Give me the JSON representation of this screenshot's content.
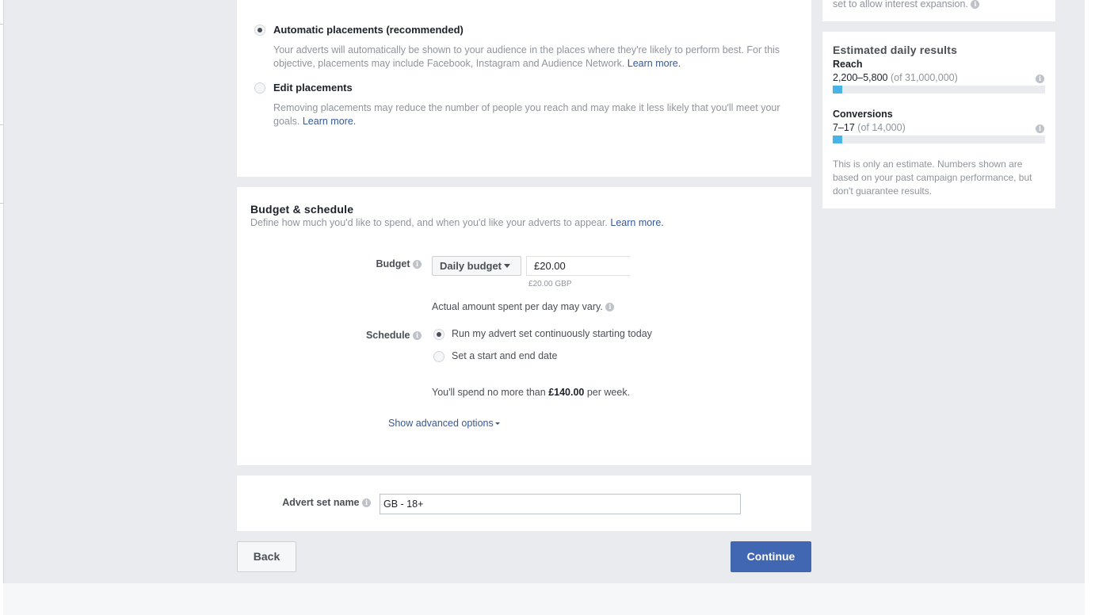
{
  "placements": {
    "options": [
      {
        "title": "Automatic placements (recommended)",
        "selected": true,
        "description": "Your adverts will automatically be shown to your audience in the places where they're likely to perform best. For this objective, placements may include Facebook, Instagram and Audience Network.",
        "link": "Learn more."
      },
      {
        "title": "Edit placements",
        "selected": false,
        "description": "Removing placements may reduce the number of people you reach and may make it less likely that you'll meet your goals.",
        "link": "Learn more."
      }
    ]
  },
  "budget_schedule": {
    "title": "Budget & schedule",
    "subtitle": "Define how much you'd like to spend, and when you'd like your adverts to appear.",
    "subtitle_link": "Learn more.",
    "budget_label": "Budget",
    "budget_type": "Daily budget",
    "budget_value": "£20.00",
    "budget_currency_note": "£20.00 GBP",
    "budget_note": "Actual amount spent per day may vary.",
    "schedule_label": "Schedule",
    "schedule_options": [
      {
        "label": "Run my advert set continuously starting today",
        "selected": true
      },
      {
        "label": "Set a start and end date",
        "selected": false
      }
    ],
    "spend_prefix": "You'll spend no more than",
    "spend_amount": "£140.00",
    "spend_suffix": "per week.",
    "advanced_link": "Show advanced options"
  },
  "advert_set": {
    "name_label": "Advert set name",
    "name_value": "GB - 18+"
  },
  "footer": {
    "back_label": "Back",
    "continue_label": "Continue"
  },
  "sidebar": {
    "top_text": "set to allow interest expansion.",
    "title": "Estimated daily results",
    "metrics": [
      {
        "label": "Reach",
        "value": "2,200–5,800",
        "of": "(of 31,000,000)",
        "fill_fraction": 0.045
      },
      {
        "label": "Conversions",
        "value": "7–17",
        "of": "(of 14,000)",
        "fill_fraction": 0.045
      }
    ],
    "note": "This is only an estimate. Numbers shown are based on your past campaign performance, but don't guarantee results."
  },
  "colors": {
    "accent": "#4267b2",
    "link": "#365899",
    "bar_fill": "#47b4e5",
    "page_bg": "#e9ebee"
  }
}
